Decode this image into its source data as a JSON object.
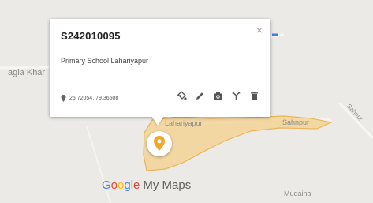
{
  "map": {
    "labels": {
      "left_village": "agla Khar",
      "center_village": "Lahariyapur",
      "right_village": "Sahnpur",
      "bottom_village": "Mudaina",
      "road": "Sahnur"
    },
    "region_fill": "#f3d497",
    "region_stroke": "#e7b65a",
    "marker_color": "#f5a623"
  },
  "info_card": {
    "title": "S242010095",
    "description": "Primary School Lahariyapur",
    "coordinates": "25.72054, 79.36508",
    "close_glyph": "×",
    "actions": [
      {
        "name": "style-icon"
      },
      {
        "name": "edit-icon"
      },
      {
        "name": "camera-icon"
      },
      {
        "name": "directions-icon"
      },
      {
        "name": "delete-icon"
      }
    ]
  },
  "branding": {
    "google_letters": [
      "G",
      "o",
      "o",
      "g",
      "l",
      "e"
    ],
    "product": "My Maps"
  }
}
